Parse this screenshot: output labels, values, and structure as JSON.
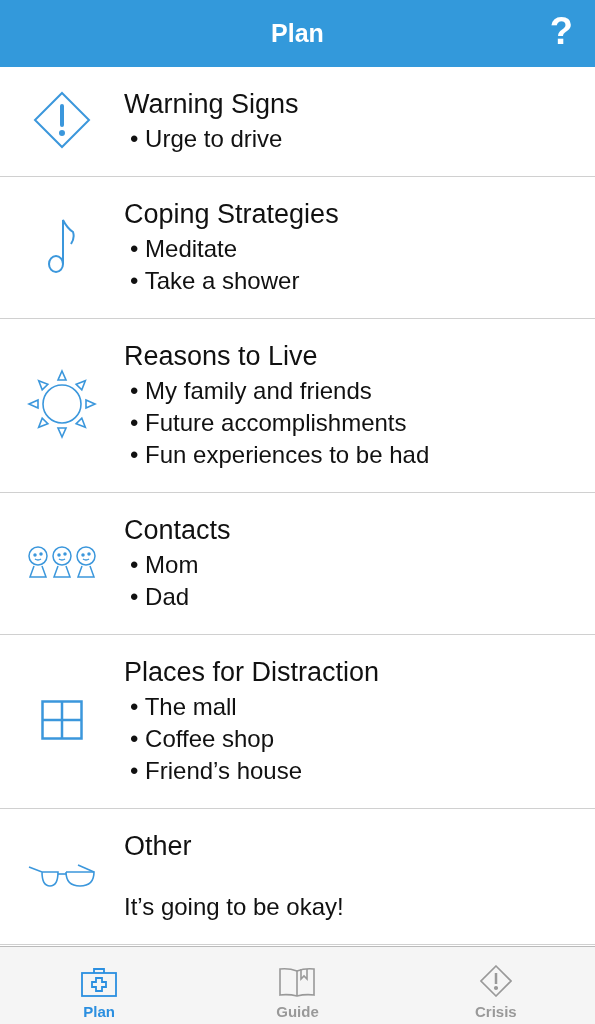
{
  "header": {
    "title": "Plan",
    "help": "?"
  },
  "sections": [
    {
      "kind": "warning",
      "title": "Warning Signs",
      "items": [
        "• Urge to drive"
      ]
    },
    {
      "kind": "music",
      "title": "Coping Strategies",
      "items": [
        "• Meditate",
        "• Take a shower"
      ]
    },
    {
      "kind": "sun",
      "title": "Reasons to Live",
      "items": [
        "• My family and friends",
        "• Future accomplishments",
        "• Fun experiences to be had"
      ]
    },
    {
      "kind": "people",
      "title": "Contacts",
      "items": [
        "• Mom",
        "• Dad"
      ]
    },
    {
      "kind": "window",
      "title": "Places for Distraction",
      "items": [
        "• The mall",
        "• Coffee shop",
        "• Friend’s house"
      ]
    },
    {
      "kind": "glasses",
      "title": "Other",
      "note": "It’s going to be okay!"
    }
  ],
  "tabs": [
    {
      "kind": "kit",
      "label": "Plan",
      "selected": true
    },
    {
      "kind": "book",
      "label": "Guide",
      "selected": false
    },
    {
      "kind": "alert",
      "label": "Crisis",
      "selected": false
    }
  ]
}
